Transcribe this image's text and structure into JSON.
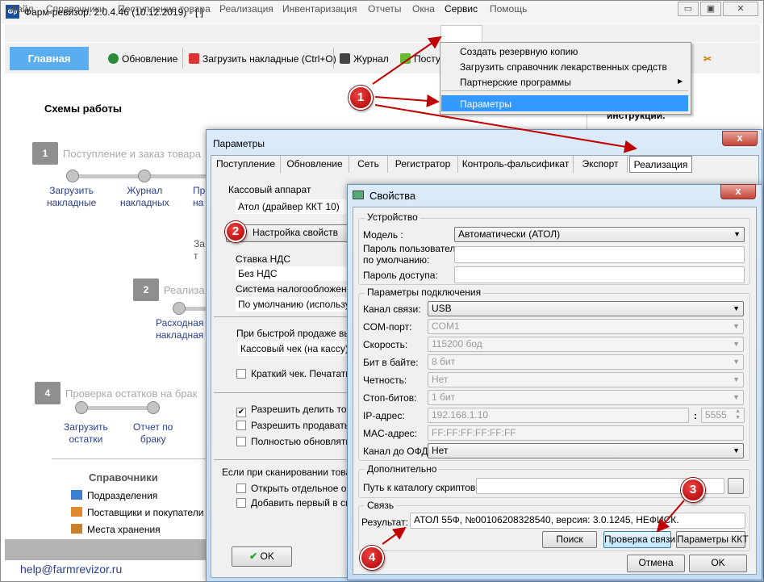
{
  "window": {
    "title": "Фарм-ревизор. 2.0.4.46 (10.12.2019) - [ ]",
    "icon_text": "Фр",
    "min": "▭",
    "max": "▣",
    "close": "✕"
  },
  "menubar": [
    "Файл",
    "Справочники",
    "Поступление товара",
    "Реализация",
    "Инвентаризация",
    "Отчеты",
    "Окна",
    "Сервис",
    "Помощь"
  ],
  "toolbar": {
    "home": "Главная",
    "update": "Обновление",
    "load": "Загрузить накладные (Ctrl+O)",
    "journal": "Журнал",
    "post": "Посту"
  },
  "service_menu": {
    "items": [
      "Создать резервную копию",
      "Загрузить справочник лекарственных средств",
      "Партнерские программы",
      "Параметры"
    ],
    "selected": "Параметры",
    "submenu_arrow": "▶"
  },
  "main": {
    "title": "Схемы работы",
    "right_text": "инструкции.",
    "scheme1": {
      "num": "1",
      "label": "Поступление и заказ товара",
      "links": [
        "Загрузить\nнакладные",
        "Журнал\nнакладных",
        "Пр\nна"
      ],
      "extra": "За\nт"
    },
    "scheme2": {
      "num": "2",
      "label": "Реализа",
      "links": [
        "Расходная\nнакладная"
      ]
    },
    "scheme4": {
      "num": "4",
      "label": "Проверка остатков на брак",
      "links": [
        "Загрузить\nостатки",
        "Отчет по\nбраку"
      ]
    },
    "refs": {
      "title": "Справочники",
      "items": [
        "Подразделения",
        "Поставщики и покупатели",
        "Места хранения"
      ]
    },
    "help": "help@farmrevizor.ru"
  },
  "params": {
    "title": "Параметры",
    "close": "x",
    "tabs": [
      "Поступление",
      "Обновление",
      "Сеть",
      "Регистратор",
      "Контроль-фальсификат",
      "Экспорт",
      "Реализация"
    ],
    "active_tab": "Реализация",
    "kassa_label": "Кассовый аппарат",
    "kassa_value": "Атол (драйвер ККТ 10)",
    "setup_button": "Настройка свойств",
    "vat_label": "Ставка НДС",
    "vat_value": "Без НДС",
    "tax_label": "Система налогообложения",
    "tax_value": "По умолчанию (использую",
    "quick_label": "При быстрой продаже выв",
    "quick_value": "Кассовый чек (на кассу)",
    "short_check": {
      "label": "Краткий чек. Печатать",
      "checked": false
    },
    "checks": [
      {
        "label": "Разрешить делить това",
        "checked": true
      },
      {
        "label": "Разрешить продавать т",
        "checked": false
      },
      {
        "label": "Полностью обновлять с",
        "checked": false
      }
    ],
    "scan_label": "Если при сканировании товар",
    "scan_checks": [
      {
        "label": "Открыть отдельное окн",
        "checked": false
      },
      {
        "label": "Добавить первый в спи",
        "checked": false
      }
    ],
    "ok": "OK"
  },
  "props": {
    "title": "Свойства",
    "close": "x",
    "device_group": "Устройство",
    "model_label": "Модель :",
    "model_value": "Автоматически (АТОЛ)",
    "user_pwd_label": "Пароль пользователя\nпо умолчанию:",
    "user_pwd_value": "",
    "access_pwd_label": "Пароль доступа:",
    "access_pwd_value": "",
    "conn_group": "Параметры подключения",
    "fields": [
      {
        "label": "Канал связи:",
        "value": "USB",
        "enabled": true
      },
      {
        "label": "COM-порт:",
        "value": "COM1",
        "enabled": false
      },
      {
        "label": "Скорость:",
        "value": "115200 бод",
        "enabled": false
      },
      {
        "label": "Бит в байте:",
        "value": "8 бит",
        "enabled": false
      },
      {
        "label": "Четность:",
        "value": "Нет",
        "enabled": false
      },
      {
        "label": "Стоп-битов:",
        "value": "1 бит",
        "enabled": false
      }
    ],
    "ip_label": "IP-адрес:",
    "ip_value": "192.168.1.10",
    "port_sep": ":",
    "port_value": "5555",
    "mac_label": "MAC-адрес:",
    "mac_value": "FF:FF:FF:FF:FF:FF",
    "ofd_label": "Канал до ОФД:",
    "ofd_value": "Нет",
    "extra_group": "Дополнительно",
    "scripts_label": "Путь к каталогу скриптов:",
    "scripts_value": "",
    "link_group": "Связь",
    "result_label": "Результат:",
    "result_value": "АТОЛ 55Ф, №00106208328540, версия: 3.0.1245, НЕФИСК.",
    "search": "Поиск",
    "check": "Проверка связи",
    "kkt": "Параметры ККТ",
    "cancel": "Отмена",
    "ok": "OK"
  },
  "callouts": [
    "1",
    "2",
    "3",
    "4"
  ],
  "colors": {
    "accent": "#3399ff",
    "home": "#5aaef0",
    "annotation": "#c00000"
  }
}
